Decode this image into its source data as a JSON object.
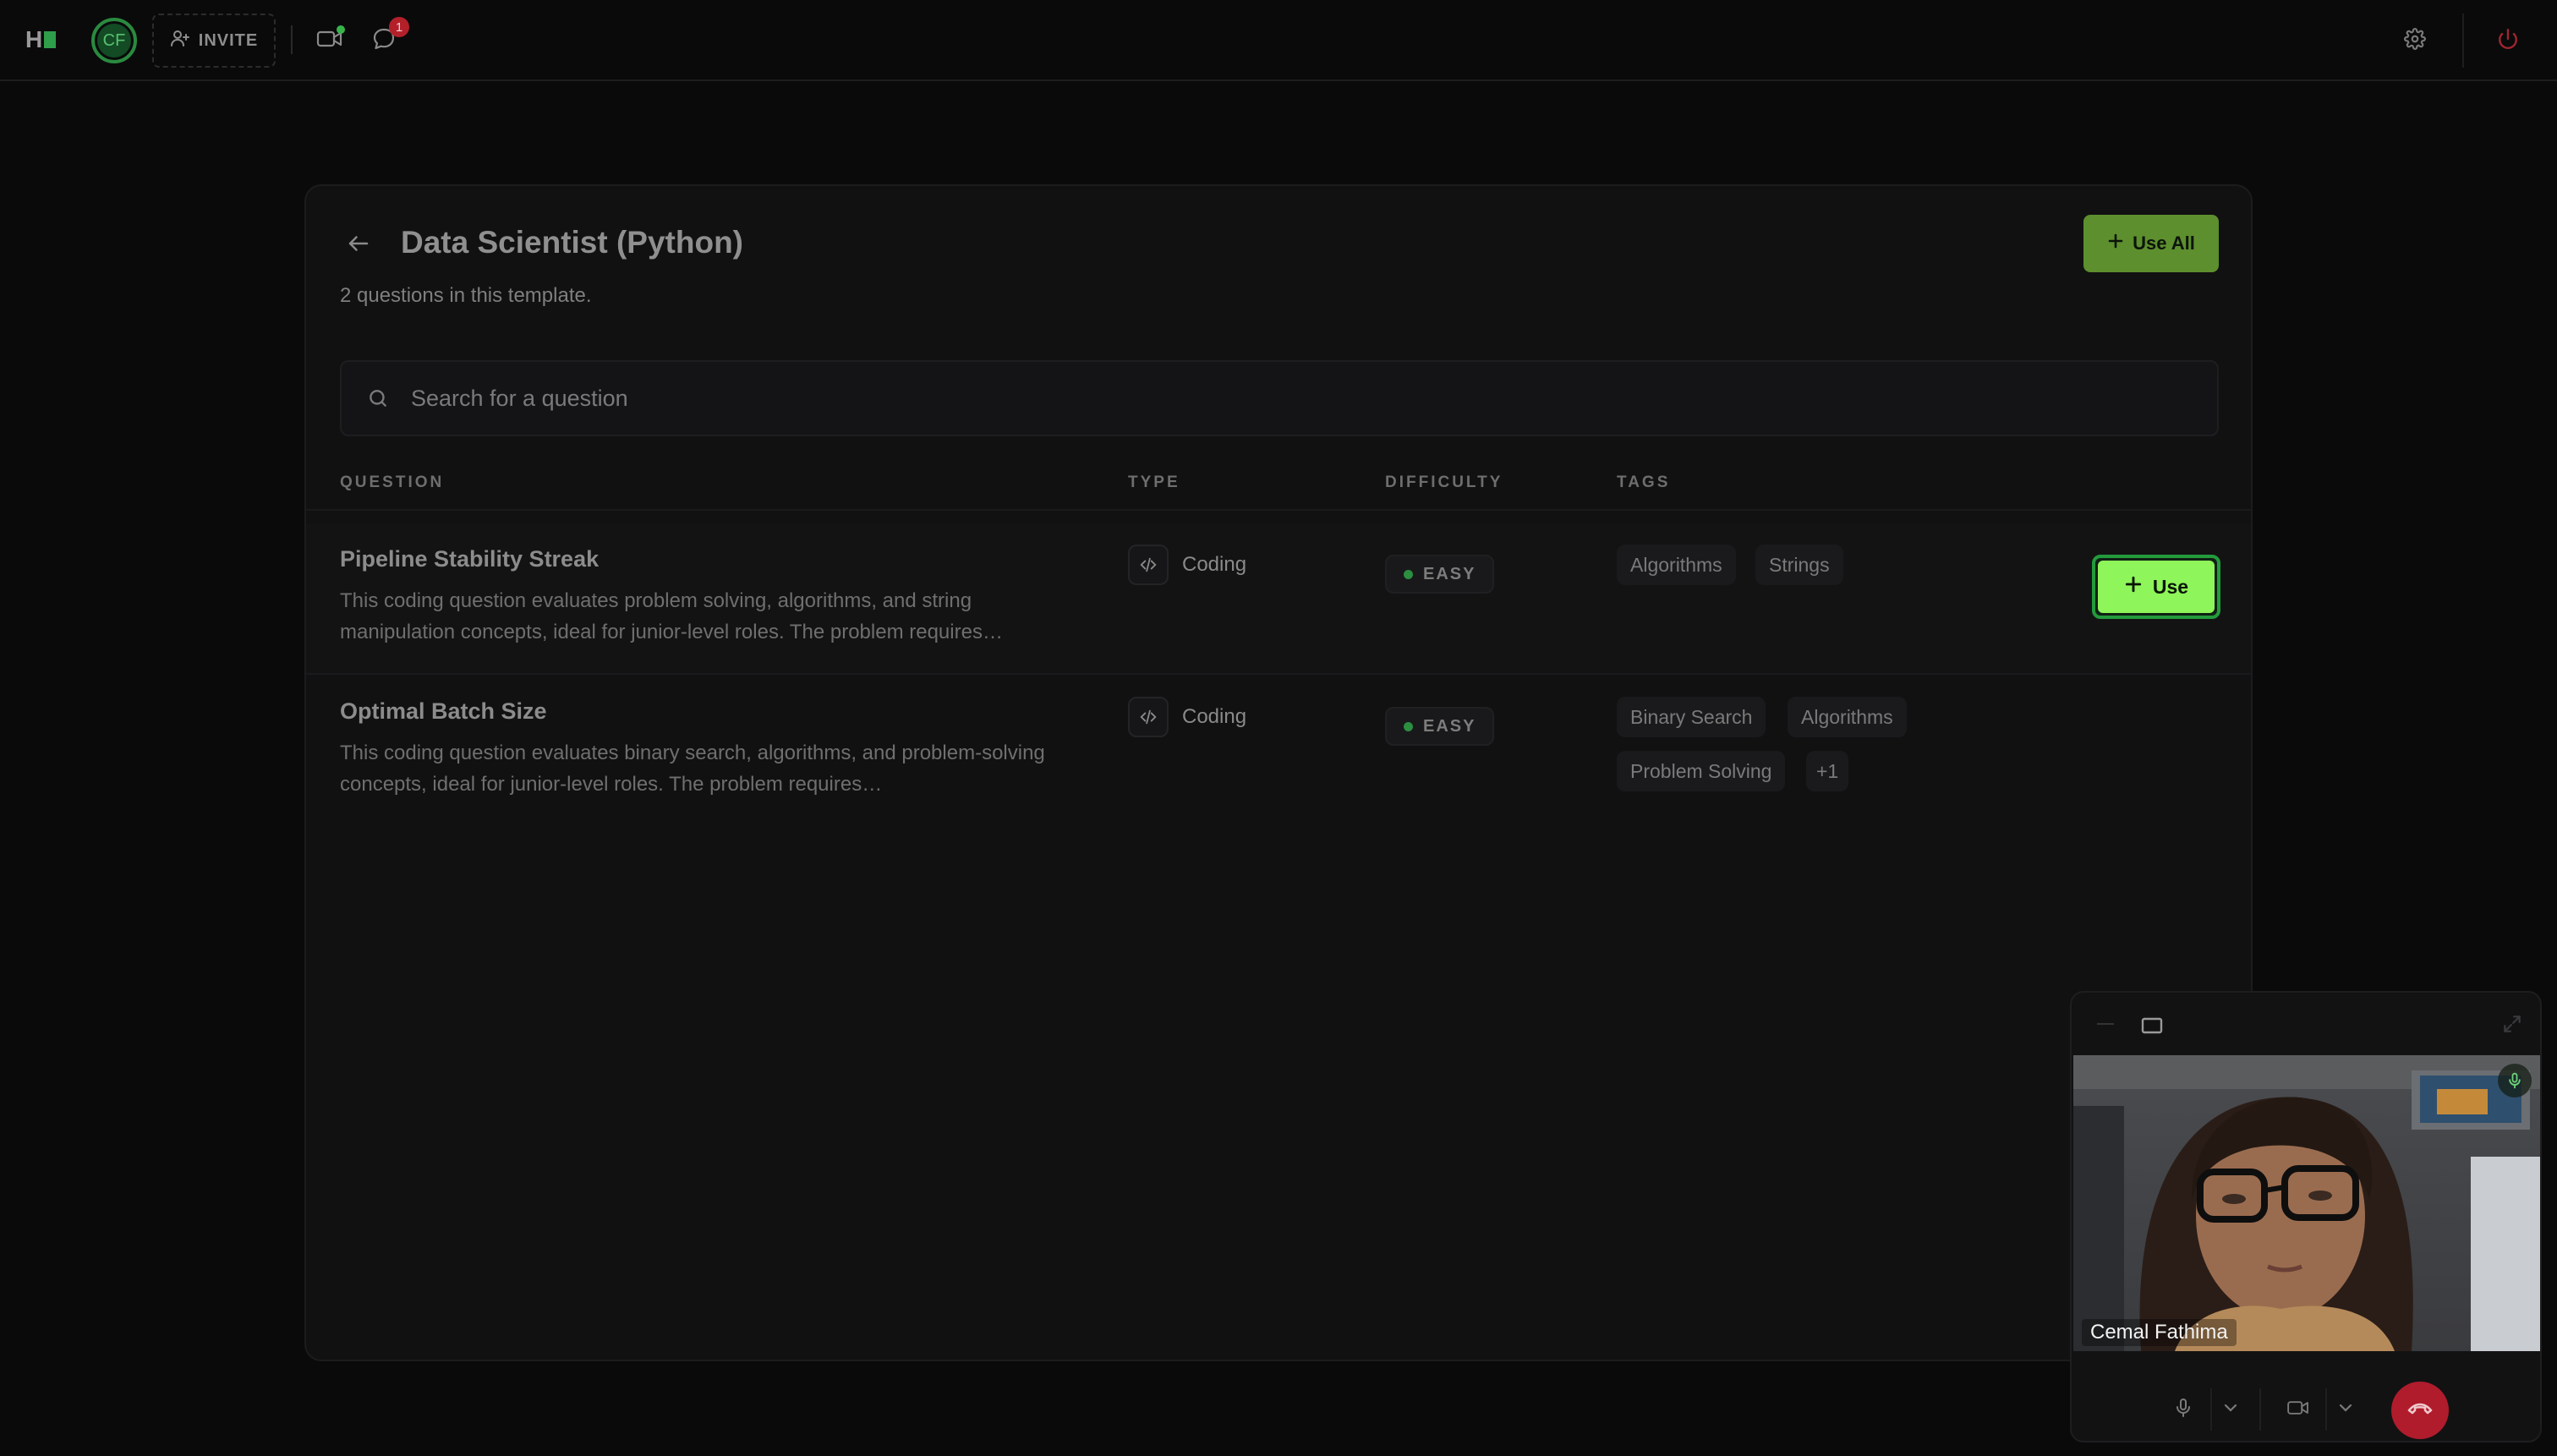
{
  "topbar": {
    "logo_text": "H",
    "avatar_initials": "CF",
    "invite_label": "INVITE",
    "notification_count": "1"
  },
  "template": {
    "title": "Data Scientist (Python)",
    "subtitle": "2 questions in this template.",
    "use_all_label": "Use All"
  },
  "search": {
    "placeholder": "Search for a question",
    "value": ""
  },
  "table": {
    "headers": {
      "question": "QUESTION",
      "type": "TYPE",
      "difficulty": "DIFFICULTY",
      "tags": "TAGS"
    },
    "rows": [
      {
        "title": "Pipeline Stability Streak",
        "description": "This coding question evaluates problem solving, algorithms, and string manipulation concepts, ideal for junior-level roles. The problem requires…",
        "type": "Coding",
        "difficulty": "EASY",
        "tags": [
          "Algorithms",
          "Strings"
        ],
        "use_label": "Use"
      },
      {
        "title": "Optimal Batch Size",
        "description": "This coding question evaluates binary search, algorithms, and problem-solving concepts, ideal for junior-level roles. The problem requires…",
        "type": "Coding",
        "difficulty": "EASY",
        "tags": [
          "Binary Search",
          "Algorithms",
          "Problem Solving"
        ],
        "more_tags": "+1"
      }
    ]
  },
  "video": {
    "participant_name": "Cemal Fathima"
  },
  "colors": {
    "accent": "#8ef55a",
    "use_all_bg": "#5d8f2e",
    "hangup": "#b01c2c",
    "easy_dot": "#2c8e40"
  }
}
